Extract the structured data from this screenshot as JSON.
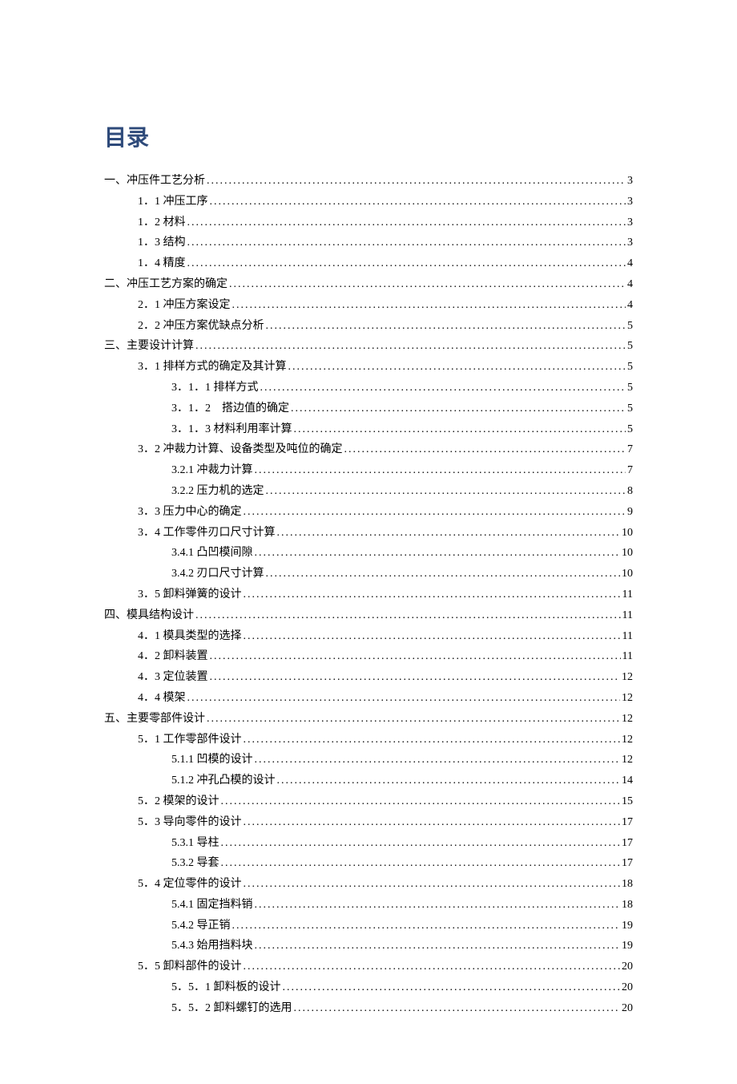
{
  "title": "目录",
  "entries": [
    {
      "level": 0,
      "text": "一、冲压件工艺分析",
      "page": "3"
    },
    {
      "level": 1,
      "text": "1．1 冲压工序",
      "page": "3"
    },
    {
      "level": 1,
      "text": "1．2 材料",
      "page": "3"
    },
    {
      "level": 1,
      "text": "1．3 结构",
      "page": "3"
    },
    {
      "level": 1,
      "text": "1．4 精度",
      "page": "4"
    },
    {
      "level": 0,
      "text": "二、冲压工艺方案的确定",
      "page": "4"
    },
    {
      "level": 1,
      "text": "2．1 冲压方案设定",
      "page": "4"
    },
    {
      "level": 1,
      "text": "2．2 冲压方案优缺点分析",
      "page": "5"
    },
    {
      "level": 0,
      "text": "三、主要设计计算",
      "page": "5"
    },
    {
      "level": 1,
      "text": "3．1 排样方式的确定及其计算",
      "page": "5"
    },
    {
      "level": 2,
      "text": "3．1．1 排样方式",
      "page": "5"
    },
    {
      "level": 2,
      "text": "3．1．2　搭边值的确定",
      "page": "5"
    },
    {
      "level": 2,
      "text": "3．1．3 材料利用率计算",
      "page": "5"
    },
    {
      "level": 1,
      "text": "3．2 冲裁力计算、设备类型及吨位的确定",
      "page": "7"
    },
    {
      "level": 2,
      "text": "3.2.1 冲裁力计算",
      "page": "7"
    },
    {
      "level": 2,
      "text": "3.2.2 压力机的选定",
      "page": "8"
    },
    {
      "level": 1,
      "text": "3．3 压力中心的确定",
      "page": "9"
    },
    {
      "level": 1,
      "text": "3．4 工作零件刃口尺寸计算",
      "page": "10"
    },
    {
      "level": 2,
      "text": "3.4.1 凸凹模间隙",
      "page": "10"
    },
    {
      "level": 2,
      "text": "3.4.2 刃口尺寸计算",
      "page": "10"
    },
    {
      "level": 1,
      "text": "3．5 卸料弹簧的设计",
      "page": "11"
    },
    {
      "level": 0,
      "text": "四、模具结构设计",
      "page": "11"
    },
    {
      "level": 1,
      "text": "4．1 模具类型的选择",
      "page": "11"
    },
    {
      "level": 1,
      "text": "4．2  卸料装置",
      "page": "11"
    },
    {
      "level": 1,
      "text": "4．3  定位装置",
      "page": "12"
    },
    {
      "level": 1,
      "text": "4．4  模架",
      "page": "12"
    },
    {
      "level": 0,
      "text": "五、主要零部件设计",
      "page": "12"
    },
    {
      "level": 1,
      "text": "5．1 工作零部件设计",
      "page": "12"
    },
    {
      "level": 2,
      "text": "5.1.1 凹模的设计",
      "page": "12"
    },
    {
      "level": 2,
      "text": "5.1.2 冲孔凸模的设计",
      "page": "14"
    },
    {
      "level": 1,
      "text": "5．2 模架的设计",
      "page": "15"
    },
    {
      "level": 1,
      "text": "5．3 导向零件的设计",
      "page": "17"
    },
    {
      "level": 2,
      "text": "5.3.1 导柱",
      "page": "17"
    },
    {
      "level": 2,
      "text": "5.3.2 导套",
      "page": "17"
    },
    {
      "level": 1,
      "text": "5．4 定位零件的设计",
      "page": "18"
    },
    {
      "level": 2,
      "text": "5.4.1 固定挡料销",
      "page": "18"
    },
    {
      "level": 2,
      "text": "5.4.2 导正销",
      "page": "19"
    },
    {
      "level": 2,
      "text": "5.4.3 始用挡料块",
      "page": "19"
    },
    {
      "level": 1,
      "text": "5．5 卸料部件的设计",
      "page": "20"
    },
    {
      "level": 2,
      "text": "5．5．1  卸料板的设计",
      "page": "20"
    },
    {
      "level": 2,
      "text": "5．5．2  卸料螺钉的选用",
      "page": "20"
    }
  ]
}
